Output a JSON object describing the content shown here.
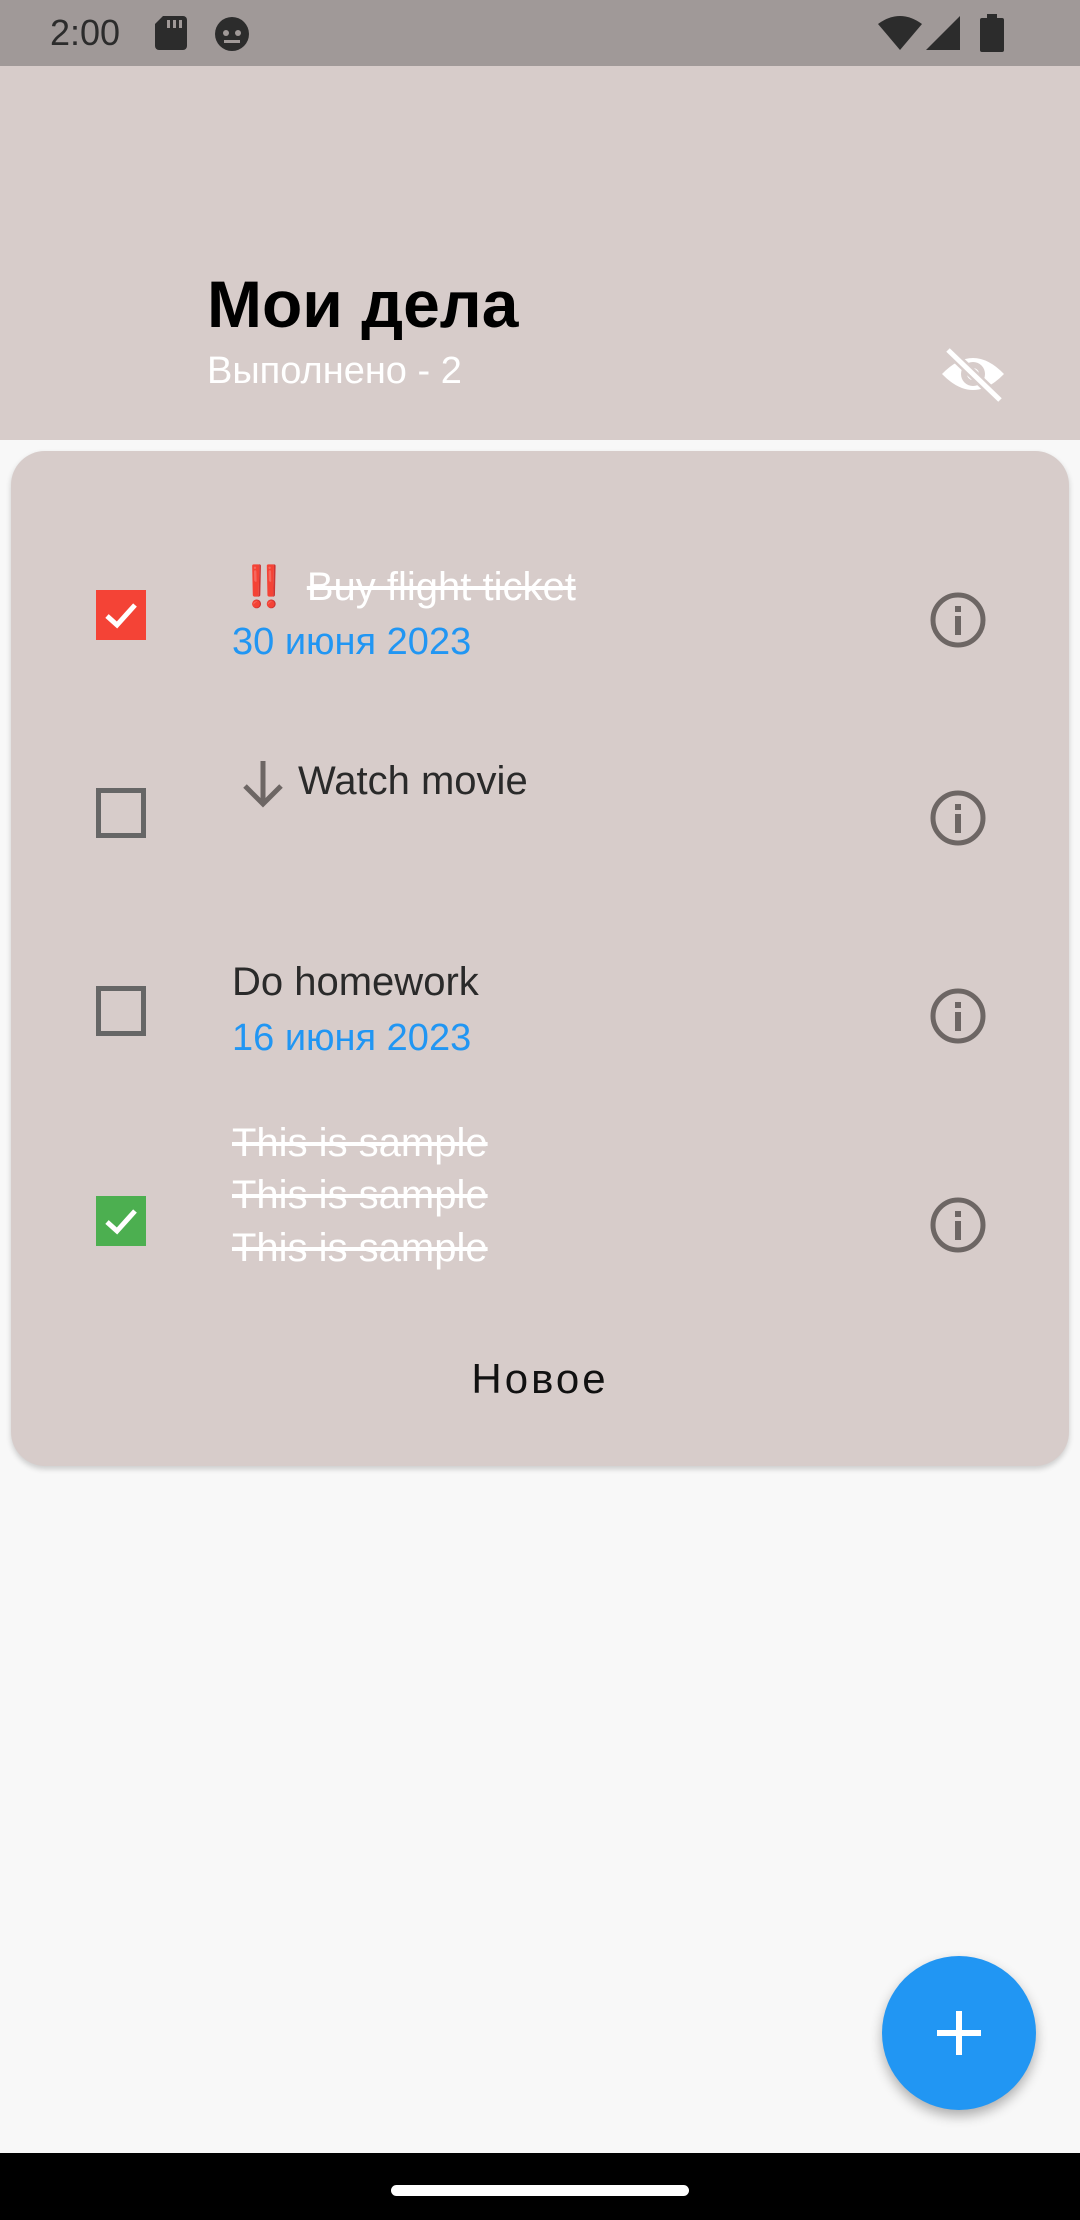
{
  "status_bar": {
    "time": "2:00"
  },
  "header": {
    "title": "Мои дела",
    "subtitle": "Выполнено - 2"
  },
  "tasks": [
    {
      "priority_icon": "double-exclamation-icon",
      "priority_text": "‼️",
      "text": "Buy flight ticket",
      "date": "30 июня 2023",
      "done": true,
      "checkbox_color": "#f44336"
    },
    {
      "priority_icon": "arrow-down-icon",
      "text": "Watch movie",
      "date": "",
      "done": false
    },
    {
      "text": "Do homework",
      "date": "16 июня 2023",
      "done": false
    },
    {
      "text_lines": [
        "This is sample",
        "This is sample",
        "This is sample"
      ],
      "done": true,
      "checkbox_color": "#4caf50"
    }
  ],
  "new_button_label": "Новое",
  "colors": {
    "accent": "#2196f3",
    "card_bg": "#d7ccca",
    "done_red": "#f44336",
    "done_green": "#4caf50"
  }
}
